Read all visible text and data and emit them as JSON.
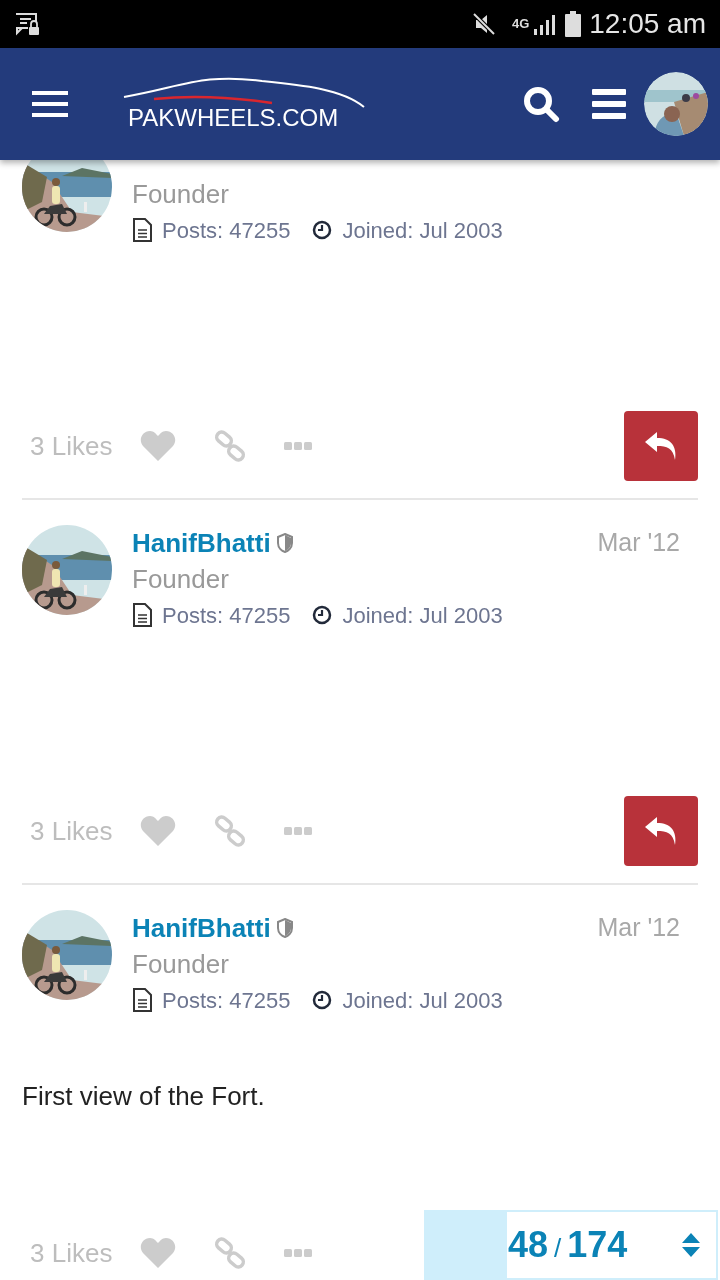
{
  "status_bar": {
    "network": "4G",
    "time": "12:05 am"
  },
  "header": {
    "logo": "PAKWHEELS.COM"
  },
  "posts": [
    {
      "role": "Founder",
      "posts": "Posts: 47255",
      "joined": "Joined: Jul 2003",
      "likes": "3 Likes",
      "liked": false
    },
    {
      "name": "HanifBhatti",
      "date": "Mar '12",
      "role": "Founder",
      "posts": "Posts: 47255",
      "joined": "Joined: Jul 2003",
      "likes": "3 Likes",
      "liked": false
    },
    {
      "name": "HanifBhatti",
      "date": "Mar '12",
      "role": "Founder",
      "posts": "Posts: 47255",
      "joined": "Joined: Jul 2003",
      "body": "First view of the Fort.",
      "likes": "3 Likes",
      "liked": false
    }
  ],
  "progress": {
    "current": "48",
    "separator": "/",
    "total": "174",
    "level": 0.28
  }
}
